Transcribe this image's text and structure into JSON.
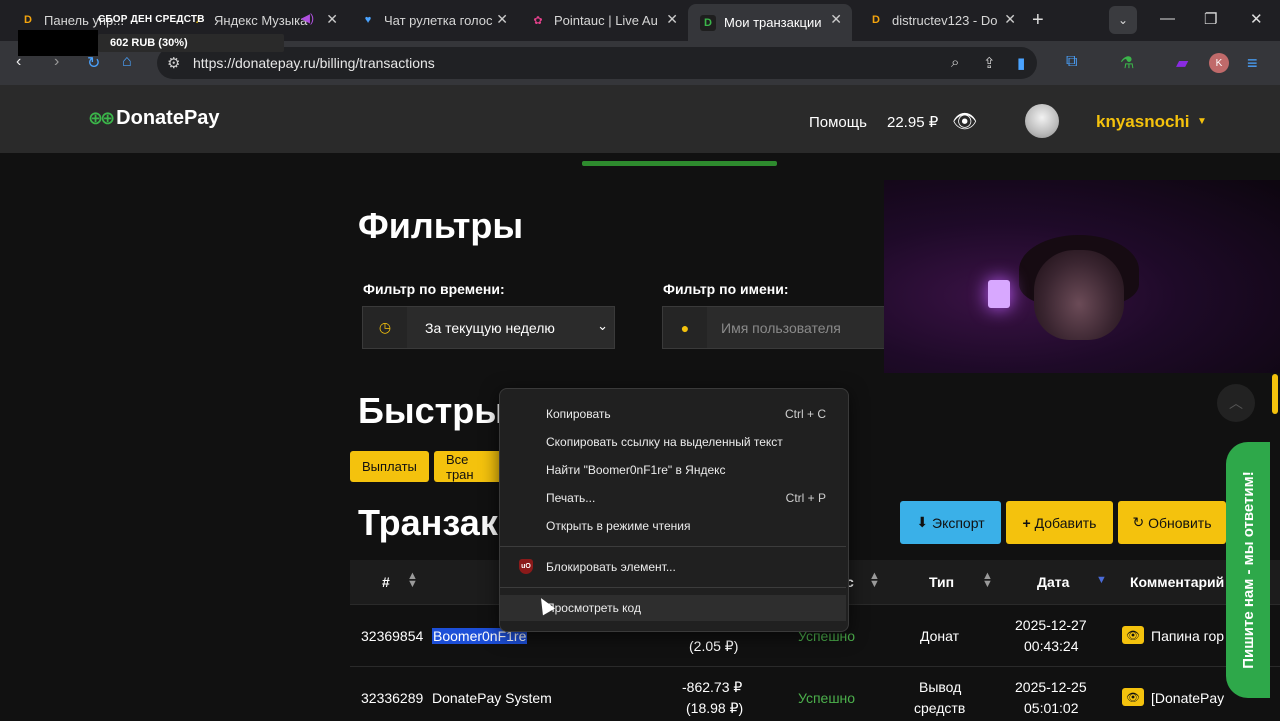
{
  "browser": {
    "tabs": [
      {
        "title": "Панель упр...",
        "favicon": "D",
        "color": "#f4a40d"
      },
      {
        "title": "Яндекс Музыка",
        "favicon": "♪",
        "color": "#f4c20d"
      },
      {
        "title": "Чат рулетка голос",
        "favicon": "♥",
        "color": "#4aa3ff"
      },
      {
        "title": "Pointauc | Live Au",
        "favicon": "✿",
        "color": "#e0408a"
      },
      {
        "title": "Мои транзакции",
        "favicon": "D",
        "color": "#3bb54a"
      },
      {
        "title": "distructev123 - Do",
        "favicon": "D",
        "color": "#f4a40d"
      }
    ],
    "url": "https://donatepay.ru/billing/transactions",
    "profile_letter": "K"
  },
  "stream_overlay": {
    "title": "СБОР ДЕН СРЕДСТВ",
    "amount": "602 RUB (30%)"
  },
  "header": {
    "brand": "DonatePay",
    "help": "Помощь",
    "balance": "22.95 ₽",
    "username": "knyasnochi"
  },
  "filters": {
    "heading": "Фильтры",
    "time_label": "Фильтр по времени:",
    "time_value": "За текущую неделю",
    "name_label": "Фильтр по имени:",
    "name_placeholder": "Имя пользователя"
  },
  "quick": {
    "heading": "Быстры",
    "buttons": [
      "Выплаты",
      "Все тран"
    ]
  },
  "transactions": {
    "heading": "Транзак",
    "export": "Экспорт",
    "add": "Добавить",
    "refresh": "Обновить",
    "columns": {
      "id": "#",
      "status": "с",
      "type": "Тип",
      "date": "Дата",
      "comment": "Комментарий"
    },
    "rows": [
      {
        "id": "32369854",
        "name": "Boomer0nF1re",
        "amount": "(2.05 ₽)",
        "status": "Успешно",
        "type": "Донат",
        "date1": "2025-12-27",
        "date2": "00:43:24",
        "comment": "Папина гор"
      },
      {
        "id": "32336289",
        "name": "DonatePay System",
        "amount1": "-862.73 ₽",
        "amount2": "(18.98 ₽)",
        "status": "Успешно",
        "type1": "Вывод",
        "type2": "средств",
        "date1": "2025-12-25",
        "date2": "05:01:02",
        "comment": "[DonatePay"
      }
    ]
  },
  "context_menu": {
    "copy": "Копировать",
    "copy_sc": "Ctrl + C",
    "copy_link": "Скопировать ссылку на выделенный текст",
    "find": "Найти \"Boomer0nF1re\" в Яндекс",
    "print": "Печать...",
    "print_sc": "Ctrl + P",
    "reader": "Открыть в режиме чтения",
    "block": "Блокировать элемент...",
    "inspect": "Просмотреть код"
  },
  "chat_tab": "Пишите нам - мы ответим!",
  "colors": {
    "accent": "#f4c20d",
    "brand_green": "#3bb54a",
    "success": "#4cb04c",
    "export_blue": "#3ab0e8"
  }
}
